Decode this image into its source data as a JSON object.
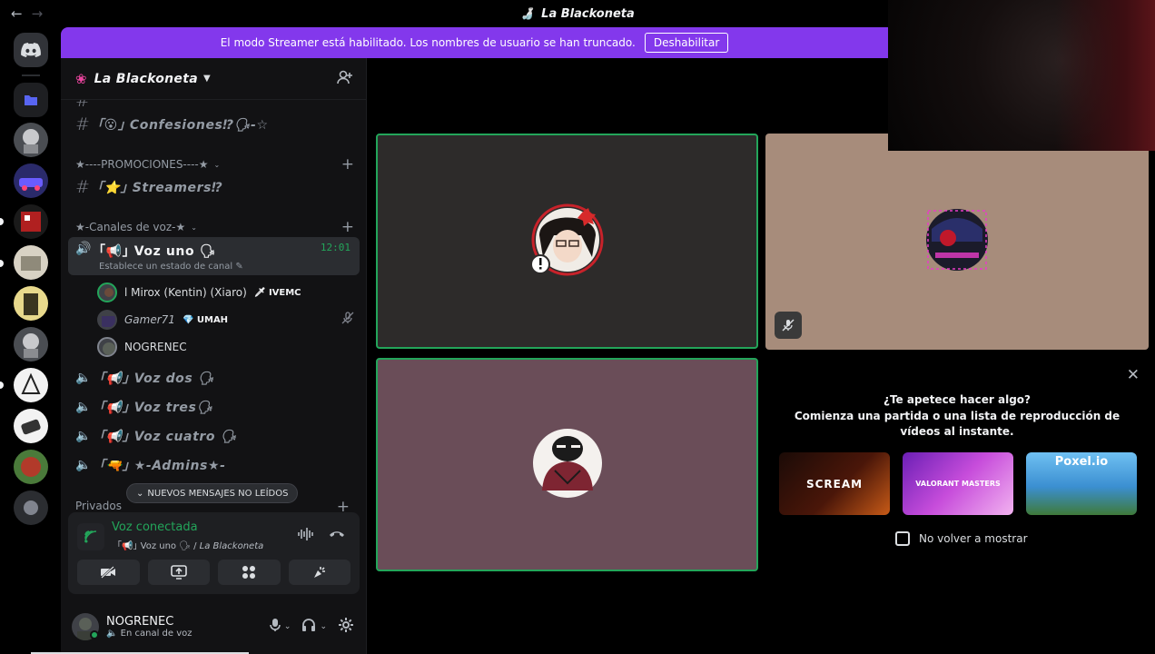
{
  "window": {
    "title": "La Blackoneta",
    "back_arrow": "←",
    "forward_arrow": "→"
  },
  "banner": {
    "text": "El modo Streamer está habilitado. Los nombres de usuario se han truncado.",
    "button": "Deshabilitar"
  },
  "guild": {
    "name": "La Blackoneta",
    "chevron": "⌄"
  },
  "channels": {
    "partial": "#  ...",
    "text_channels": [
      {
        "emoji": "😮",
        "name": "Confesiones⁉🗣-☆",
        "prefix": "｢",
        "suffix": "｣"
      },
      {
        "emoji": "⭐",
        "name": "Streamers⁉",
        "prefix": "｢",
        "suffix": "｣"
      }
    ],
    "cat_promos": "★----PROMOCIONES----★",
    "cat_voice": "★-Canales de voz-★",
    "active_voice": {
      "label": "｢📢｣ Voz uno 🗣",
      "time": "12:01",
      "status": "Establece un estado de canal ✎"
    },
    "voice_users": [
      {
        "name": "l Mirox (Kentin) (Xiaro)",
        "tag": "🗡 IVEMC"
      },
      {
        "name": "Gamer71",
        "tag": "💎 UMAH"
      },
      {
        "name": "NOGRENEC",
        "tag": ""
      }
    ],
    "voice_channels": [
      {
        "label": "｢📢｣ Voz dos 🗣"
      },
      {
        "label": "｢📢｣ Voz tres🗣"
      },
      {
        "label": "｢📢｣ Voz cuatro 🗣"
      },
      {
        "label": "｢🔫｣ ★-Admins★-"
      }
    ],
    "new_unread": "NUEVOS MENSAJES NO LEÍDOS",
    "privados": "Privados"
  },
  "voice_panel": {
    "title": "Voz conectada",
    "channel": "｢📢｣ Voz uno 🗣",
    "separator": " / ",
    "server": "La Blackoneta"
  },
  "user": {
    "name": "NOGRENEC",
    "status": "En canal de voz"
  },
  "activity": {
    "question": "¿Te apetece hacer algo?",
    "subtitle": "Comienza una partida o una lista de reproducción de vídeos al instante.",
    "cards": [
      {
        "label": "SCREAM"
      },
      {
        "label": "VALORANT MASTERS"
      },
      {
        "label": "Poxel.io"
      }
    ],
    "checkbox": "No volver a mostrar"
  },
  "colors": {
    "accent": "#8338ec",
    "speaking": "#23a55a",
    "sidebar_bg": "#121214"
  }
}
